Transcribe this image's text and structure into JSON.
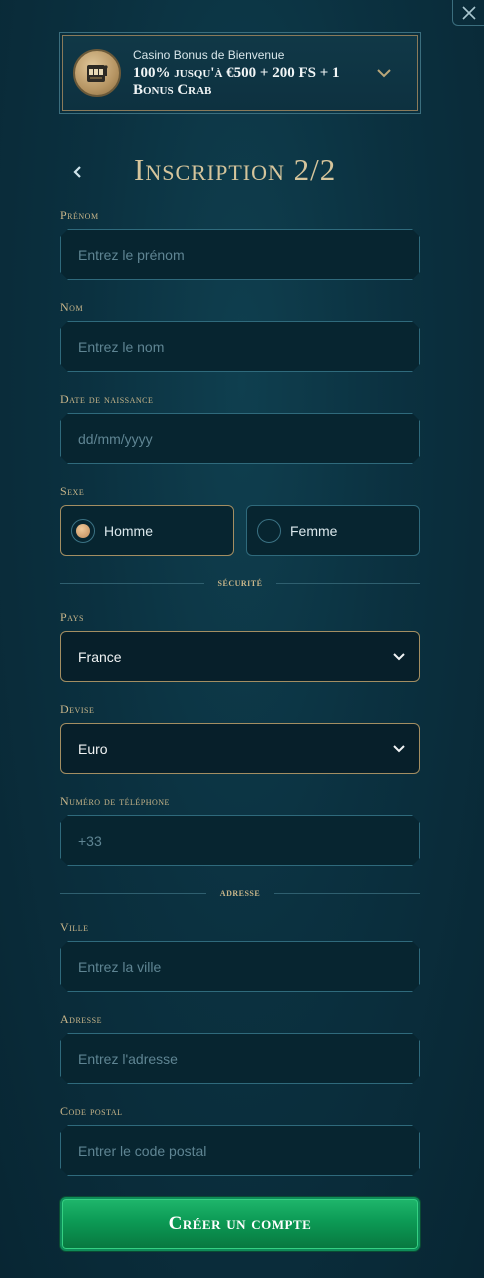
{
  "bonus": {
    "label": "Casino Bonus de Bienvenue",
    "offer": "100% jusqu'à €500 + 200 FS + 1 Bonus Crab"
  },
  "title": "Inscription 2/2",
  "fields": {
    "firstname": {
      "label": "Prénom",
      "placeholder": "Entrez le prénom"
    },
    "lastname": {
      "label": "Nom",
      "placeholder": "Entrez le nom"
    },
    "birthdate": {
      "label": "Date de naissance",
      "placeholder": "dd/mm/yyyy"
    },
    "gender": {
      "label": "Sexe",
      "male": "Homme",
      "female": "Femme",
      "selected": "Homme"
    },
    "country": {
      "label": "Pays",
      "value": "France"
    },
    "currency": {
      "label": "Devise",
      "value": "Euro"
    },
    "phone": {
      "label": "Numéro de téléphone",
      "placeholder": "+33"
    },
    "city": {
      "label": "Ville",
      "placeholder": "Entrez la ville"
    },
    "address": {
      "label": "Adresse",
      "placeholder": "Entrez l'adresse"
    },
    "postal": {
      "label": "Code postal",
      "placeholder": "Entrer le code postal"
    }
  },
  "sections": {
    "security": "sécurité",
    "address": "adresse"
  },
  "submit_label": "Créer un compte",
  "icons": {
    "close": "close-icon",
    "back": "chevron-left-icon",
    "expand": "chevron-down-icon",
    "badge": "slot-machine-icon"
  },
  "colors": {
    "accent_gold": "#c9b68a",
    "submit_green": "#0c9a55"
  }
}
